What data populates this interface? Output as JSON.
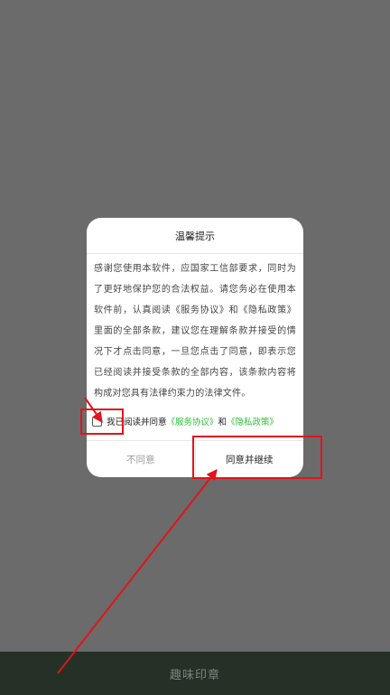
{
  "dialog": {
    "title": "温馨提示",
    "body": "感谢您使用本软件，应国家工信部要求，同时为了更好地保护您的合法权益。请您务必在使用本软件前，认真阅读《服务协议》和《隐私政策》里面的全部条款，建议您在理解条款并接受的情况下才点击同意，一旦您点击了同意，即表示您已经阅读并接受条款的全部内容，该条款内容将构成对您具有法律约束力的法律文件。",
    "consent": {
      "prefix": "我已阅读并同意",
      "service_link": "《服务协议》",
      "conjunction": "和",
      "privacy_link": "《隐私政策》",
      "checked": false
    },
    "disagree_label": "不同意",
    "agree_label": "同意并继续"
  },
  "bottom_bar": {
    "app_name": "趣味印章"
  },
  "colors": {
    "overlay": "#6b6b6b",
    "bottom_bar": "#253127",
    "link": "#2fbf3a",
    "annotation": "#e0141a"
  }
}
